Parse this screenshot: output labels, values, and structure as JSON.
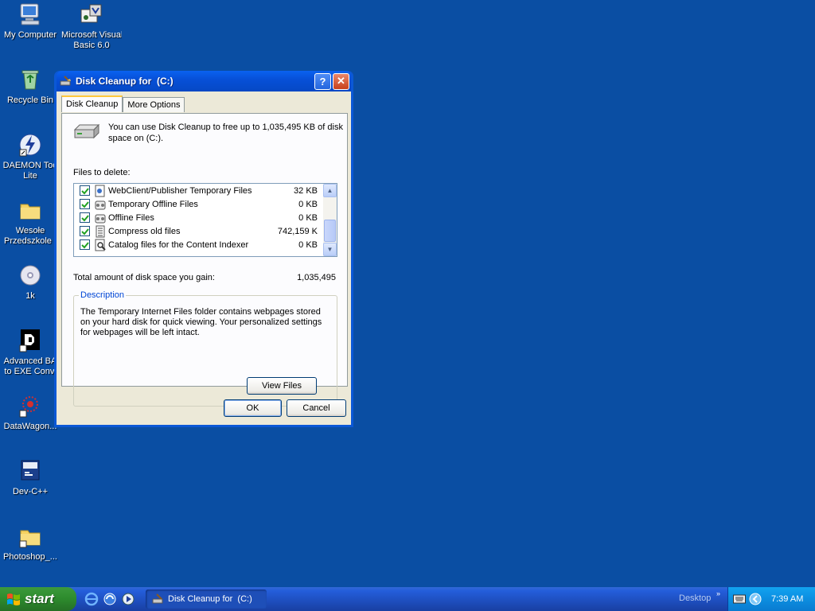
{
  "desktop": {
    "icons": [
      {
        "label_line1": "My Computer",
        "label_line2": ""
      },
      {
        "label_line1": "Microsoft Visual",
        "label_line2": "Basic 6.0"
      },
      {
        "label_line1": "Recycle Bin",
        "label_line2": ""
      },
      {
        "label_line1": "DAEMON Too",
        "label_line2": "Lite"
      },
      {
        "label_line1": "Wesołe",
        "label_line2": "Przedszkole ."
      },
      {
        "label_line1": "1k",
        "label_line2": ""
      },
      {
        "label_line1": "Advanced BA",
        "label_line2": "to EXE Conv."
      },
      {
        "label_line1": "DataWagon...",
        "label_line2": ""
      },
      {
        "label_line1": "Dev-C++",
        "label_line2": ""
      },
      {
        "label_line1": "Photoshop_...",
        "label_line2": ""
      }
    ]
  },
  "dialog": {
    "title": "Disk Cleanup for  (C:)",
    "help_glyph": "?",
    "close_glyph": "✕",
    "tabs": [
      {
        "label": "Disk Cleanup",
        "active": true
      },
      {
        "label": "More Options",
        "active": false
      }
    ],
    "intro": "You can use Disk Cleanup to free up to 1,035,495 KB of disk space on  (C:).",
    "files_label": "Files to delete:",
    "files": [
      {
        "name": "WebClient/Publisher Temporary Files",
        "size": "32 KB",
        "checked": true,
        "icon": "webclient-icon"
      },
      {
        "name": "Temporary Offline Files",
        "size": "0 KB",
        "checked": true,
        "icon": "offline-files-icon"
      },
      {
        "name": "Offline Files",
        "size": "0 KB",
        "checked": true,
        "icon": "offline-files-icon"
      },
      {
        "name": "Compress old files",
        "size": "742,159 K",
        "checked": true,
        "icon": "compress-icon"
      },
      {
        "name": "Catalog files for the Content Indexer",
        "size": "0 KB",
        "checked": true,
        "icon": "catalog-icon"
      }
    ],
    "total_label": "Total amount of disk space you gain:",
    "total_value": "1,035,495",
    "description_legend": "Description",
    "description_text": "The Temporary Internet Files folder contains webpages stored on your hard disk for quick viewing. Your personalized settings for webpages will be left intact.",
    "view_files_label": "View Files",
    "ok_label": "OK",
    "cancel_label": "Cancel"
  },
  "taskbar": {
    "start_label": "start",
    "task_label": "Disk Cleanup for  (C:)",
    "desktop_toolbar_label": "Desktop",
    "clock": "7:39 AM"
  },
  "colors": {
    "desktop_bg": "#0a4ea3",
    "title_bar": "#0750d8",
    "start_green": "#2d8a2d",
    "tray_blue": "#0c8ee0"
  }
}
